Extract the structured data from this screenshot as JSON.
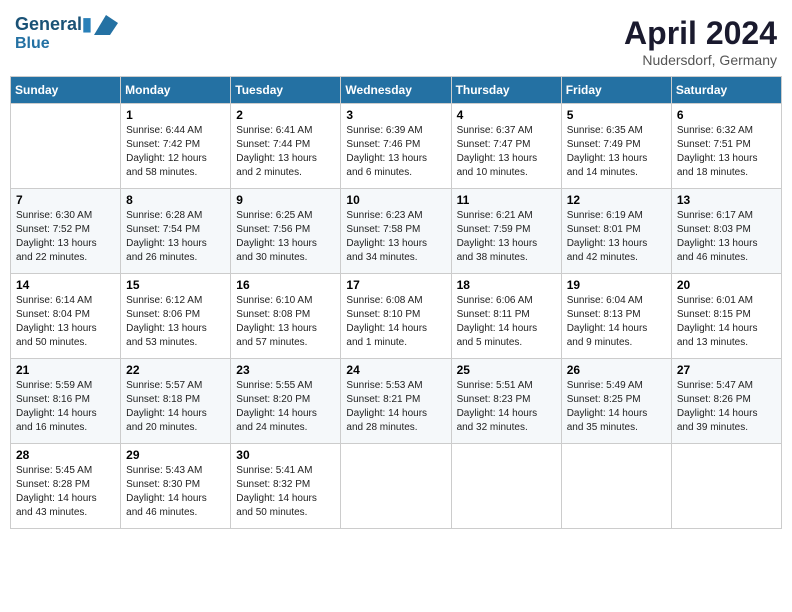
{
  "header": {
    "logo_line1": "General",
    "logo_line2": "Blue",
    "month": "April 2024",
    "location": "Nudersdorf, Germany"
  },
  "weekdays": [
    "Sunday",
    "Monday",
    "Tuesday",
    "Wednesday",
    "Thursday",
    "Friday",
    "Saturday"
  ],
  "weeks": [
    [
      {
        "day": "",
        "info": ""
      },
      {
        "day": "1",
        "info": "Sunrise: 6:44 AM\nSunset: 7:42 PM\nDaylight: 12 hours\nand 58 minutes."
      },
      {
        "day": "2",
        "info": "Sunrise: 6:41 AM\nSunset: 7:44 PM\nDaylight: 13 hours\nand 2 minutes."
      },
      {
        "day": "3",
        "info": "Sunrise: 6:39 AM\nSunset: 7:46 PM\nDaylight: 13 hours\nand 6 minutes."
      },
      {
        "day": "4",
        "info": "Sunrise: 6:37 AM\nSunset: 7:47 PM\nDaylight: 13 hours\nand 10 minutes."
      },
      {
        "day": "5",
        "info": "Sunrise: 6:35 AM\nSunset: 7:49 PM\nDaylight: 13 hours\nand 14 minutes."
      },
      {
        "day": "6",
        "info": "Sunrise: 6:32 AM\nSunset: 7:51 PM\nDaylight: 13 hours\nand 18 minutes."
      }
    ],
    [
      {
        "day": "7",
        "info": "Sunrise: 6:30 AM\nSunset: 7:52 PM\nDaylight: 13 hours\nand 22 minutes."
      },
      {
        "day": "8",
        "info": "Sunrise: 6:28 AM\nSunset: 7:54 PM\nDaylight: 13 hours\nand 26 minutes."
      },
      {
        "day": "9",
        "info": "Sunrise: 6:25 AM\nSunset: 7:56 PM\nDaylight: 13 hours\nand 30 minutes."
      },
      {
        "day": "10",
        "info": "Sunrise: 6:23 AM\nSunset: 7:58 PM\nDaylight: 13 hours\nand 34 minutes."
      },
      {
        "day": "11",
        "info": "Sunrise: 6:21 AM\nSunset: 7:59 PM\nDaylight: 13 hours\nand 38 minutes."
      },
      {
        "day": "12",
        "info": "Sunrise: 6:19 AM\nSunset: 8:01 PM\nDaylight: 13 hours\nand 42 minutes."
      },
      {
        "day": "13",
        "info": "Sunrise: 6:17 AM\nSunset: 8:03 PM\nDaylight: 13 hours\nand 46 minutes."
      }
    ],
    [
      {
        "day": "14",
        "info": "Sunrise: 6:14 AM\nSunset: 8:04 PM\nDaylight: 13 hours\nand 50 minutes."
      },
      {
        "day": "15",
        "info": "Sunrise: 6:12 AM\nSunset: 8:06 PM\nDaylight: 13 hours\nand 53 minutes."
      },
      {
        "day": "16",
        "info": "Sunrise: 6:10 AM\nSunset: 8:08 PM\nDaylight: 13 hours\nand 57 minutes."
      },
      {
        "day": "17",
        "info": "Sunrise: 6:08 AM\nSunset: 8:10 PM\nDaylight: 14 hours\nand 1 minute."
      },
      {
        "day": "18",
        "info": "Sunrise: 6:06 AM\nSunset: 8:11 PM\nDaylight: 14 hours\nand 5 minutes."
      },
      {
        "day": "19",
        "info": "Sunrise: 6:04 AM\nSunset: 8:13 PM\nDaylight: 14 hours\nand 9 minutes."
      },
      {
        "day": "20",
        "info": "Sunrise: 6:01 AM\nSunset: 8:15 PM\nDaylight: 14 hours\nand 13 minutes."
      }
    ],
    [
      {
        "day": "21",
        "info": "Sunrise: 5:59 AM\nSunset: 8:16 PM\nDaylight: 14 hours\nand 16 minutes."
      },
      {
        "day": "22",
        "info": "Sunrise: 5:57 AM\nSunset: 8:18 PM\nDaylight: 14 hours\nand 20 minutes."
      },
      {
        "day": "23",
        "info": "Sunrise: 5:55 AM\nSunset: 8:20 PM\nDaylight: 14 hours\nand 24 minutes."
      },
      {
        "day": "24",
        "info": "Sunrise: 5:53 AM\nSunset: 8:21 PM\nDaylight: 14 hours\nand 28 minutes."
      },
      {
        "day": "25",
        "info": "Sunrise: 5:51 AM\nSunset: 8:23 PM\nDaylight: 14 hours\nand 32 minutes."
      },
      {
        "day": "26",
        "info": "Sunrise: 5:49 AM\nSunset: 8:25 PM\nDaylight: 14 hours\nand 35 minutes."
      },
      {
        "day": "27",
        "info": "Sunrise: 5:47 AM\nSunset: 8:26 PM\nDaylight: 14 hours\nand 39 minutes."
      }
    ],
    [
      {
        "day": "28",
        "info": "Sunrise: 5:45 AM\nSunset: 8:28 PM\nDaylight: 14 hours\nand 43 minutes."
      },
      {
        "day": "29",
        "info": "Sunrise: 5:43 AM\nSunset: 8:30 PM\nDaylight: 14 hours\nand 46 minutes."
      },
      {
        "day": "30",
        "info": "Sunrise: 5:41 AM\nSunset: 8:32 PM\nDaylight: 14 hours\nand 50 minutes."
      },
      {
        "day": "",
        "info": ""
      },
      {
        "day": "",
        "info": ""
      },
      {
        "day": "",
        "info": ""
      },
      {
        "day": "",
        "info": ""
      }
    ]
  ]
}
